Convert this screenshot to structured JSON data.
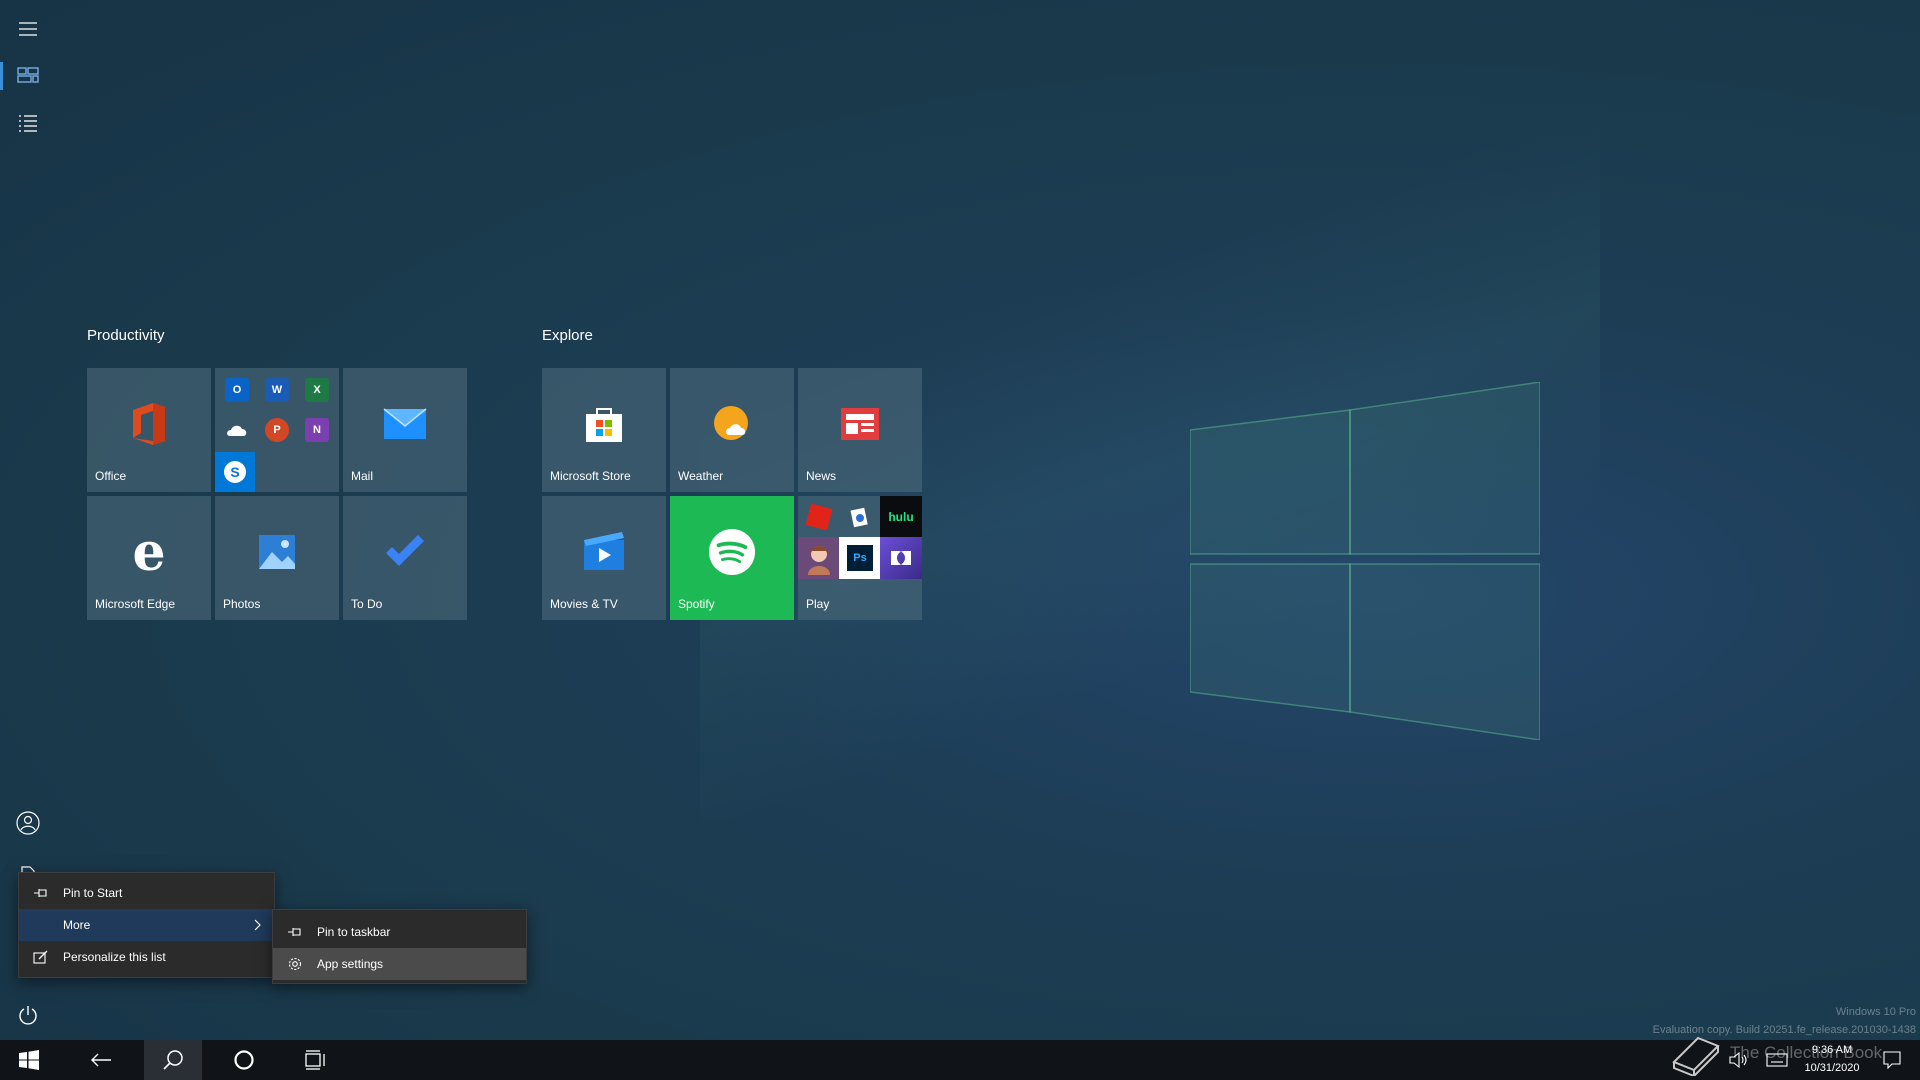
{
  "groups": [
    {
      "title": "Productivity",
      "tiles": [
        {
          "label": "Office",
          "icon": "office-icon"
        },
        {
          "label": "",
          "icon": "office-apps-folder-icon",
          "apps": [
            "outlook-icon",
            "word-icon",
            "excel-icon",
            "onedrive-icon",
            "powerpoint-icon",
            "onenote-icon",
            "skype-icon"
          ]
        },
        {
          "label": "Mail",
          "icon": "mail-icon"
        },
        {
          "label": "Microsoft Edge",
          "icon": "edge-icon"
        },
        {
          "label": "Photos",
          "icon": "photos-icon"
        },
        {
          "label": "To Do",
          "icon": "todo-icon"
        }
      ]
    },
    {
      "title": "Explore",
      "tiles": [
        {
          "label": "Microsoft Store",
          "icon": "store-icon"
        },
        {
          "label": "Weather",
          "icon": "weather-icon"
        },
        {
          "label": "News",
          "icon": "news-icon"
        },
        {
          "label": "Movies & TV",
          "icon": "movies-tv-icon"
        },
        {
          "label": "Spotify",
          "icon": "spotify-icon"
        },
        {
          "label": "Play",
          "icon": "play-folder-icon",
          "apps_text": [
            "hulu",
            "Ps"
          ]
        }
      ]
    }
  ],
  "context_menu": {
    "items": [
      {
        "label": "Pin to Start",
        "icon": "pin-icon"
      },
      {
        "label": "More",
        "icon": "",
        "has_submenu": true
      },
      {
        "label": "Personalize this list",
        "icon": "personalize-icon"
      }
    ],
    "submenu": [
      {
        "label": "Pin to taskbar",
        "icon": "pin-icon"
      },
      {
        "label": "App settings",
        "icon": "gear-icon"
      }
    ]
  },
  "watermark": {
    "line1": "Windows 10 Pro",
    "line2": "Evaluation copy. Build 20251.fe_release.201030-1438"
  },
  "tray": {
    "time": "9:36 AM",
    "date": "10/31/2020",
    "overlay_text": "The Collection Book"
  },
  "colors": {
    "accent": "#3a8fd9",
    "spotify": "#1db954",
    "menu_active": "#1f3a5a",
    "menu_hover": "#4b4b4b",
    "taskbar": "#101318"
  }
}
